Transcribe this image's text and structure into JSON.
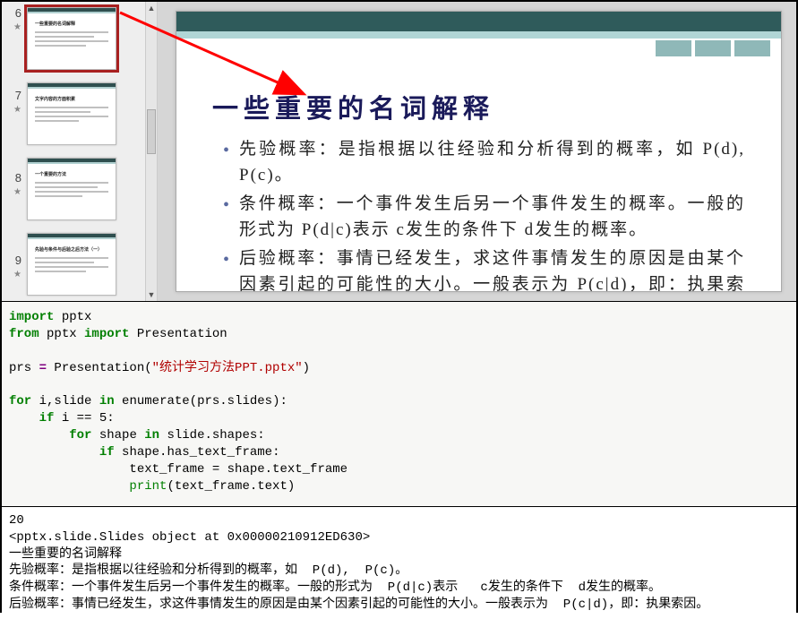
{
  "thumbs": [
    {
      "num": "6",
      "title": "一些重要的名词解释",
      "selected": true
    },
    {
      "num": "7",
      "title": "文字内容的方面积累",
      "selected": false
    },
    {
      "num": "8",
      "title": "一个重要的方法",
      "selected": false
    },
    {
      "num": "9",
      "title": "先验与条件与后验之后方法（一）",
      "selected": false
    }
  ],
  "slide": {
    "title": "一些重要的名词解释",
    "bullets": [
      "先验概率：是指根据以往经验和分析得到的概率，如 P(d), P(c)。",
      "条件概率：一个事件发生后另一个事件发生的概率。一般的形式为 P(d|c)表示 c发生的条件下 d发生的概率。",
      "后验概率：事情已经发生，求这件事情发生的原因是由某个因素引起的可能性的大小。一般表示为 P(c|d)，即：执果索因。"
    ]
  },
  "code": {
    "kw_import1": "import",
    "mod_pptx": " pptx",
    "kw_from": "from",
    "mod_pptx2": " pptx ",
    "kw_import2": "import",
    "cls_pres": " Presentation",
    "var_prs": "prs ",
    "op_eq": "=",
    "call_pres": " Presentation(",
    "str_file": "\"统计学习方法PPT.pptx\"",
    "close_paren": ")",
    "kw_for1": "for",
    "for1_mid": " i,slide ",
    "kw_in1": "in",
    "for1_tail": " enumerate(prs.slides):",
    "kw_if1": "if",
    "if1_tail": " i == 5:",
    "kw_for2": "for",
    "for2_mid": " shape ",
    "kw_in2": "in",
    "for2_tail": " slide.shapes:",
    "kw_if2": "if",
    "if2_tail": " shape.has_text_frame:",
    "line_assign": "                text_frame = shape.text_frame",
    "bi_print": "print",
    "print_tail": "(text_frame.text)"
  },
  "output": {
    "l1": "20",
    "l2": "<pptx.slide.Slides object at 0x00000210912ED630>",
    "l3": "一些重要的名词解释",
    "l4": "先验概率：是指根据以往经验和分析得到的概率，如  P(d),  P(c)。",
    "l5": "条件概率：一个事件发生后另一个事件发生的概率。一般的形式为  P(d|c)表示   c发生的条件下  d发生的概率。",
    "l6": "后验概率：事情已经发生，求这件事情发生的原因是由某个因素引起的可能性的大小。一般表示为  P(c|d)，即：执果索因。"
  }
}
